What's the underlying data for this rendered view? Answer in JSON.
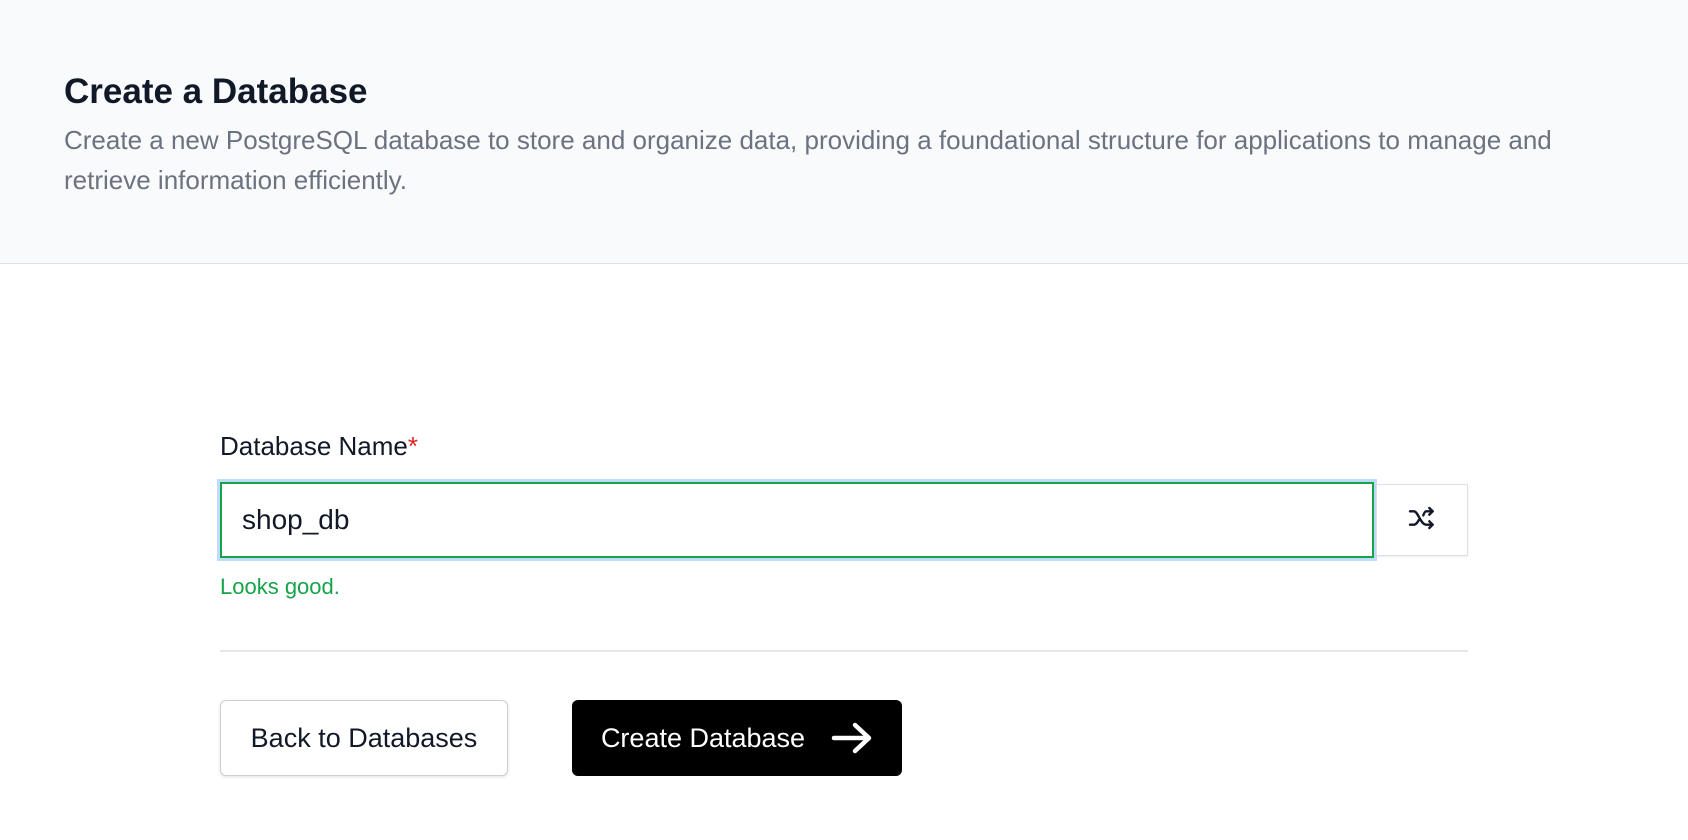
{
  "header": {
    "title": "Create a Database",
    "description": "Create a new PostgreSQL database to store and organize data, providing a foundational structure for applications to manage and retrieve information efficiently."
  },
  "form": {
    "name_label": "Database Name",
    "required_marker": "*",
    "name_value": "shop_db",
    "validation_message": "Looks good.",
    "shuffle_icon": "shuffle-icon"
  },
  "actions": {
    "back_label": "Back to Databases",
    "create_label": "Create Database",
    "create_icon": "arrow-right-icon"
  },
  "colors": {
    "header_bg": "#f9fafb",
    "valid": "#16a34a",
    "required": "#dc2626",
    "primary_button": "#000000"
  }
}
